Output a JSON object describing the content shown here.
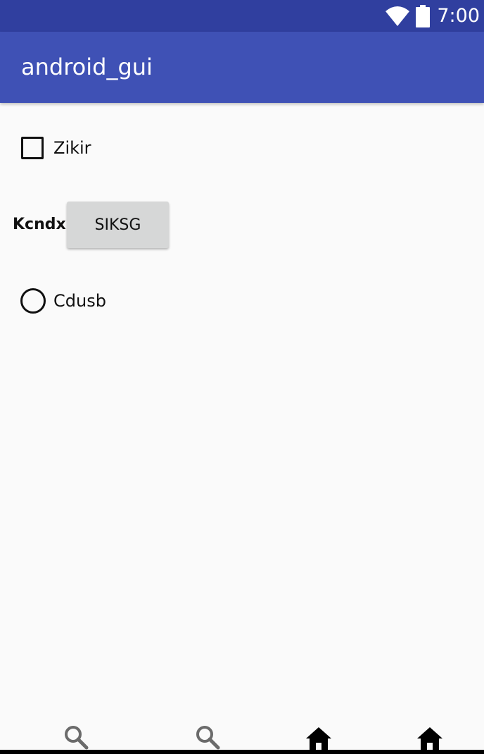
{
  "status_bar": {
    "time": "7:00",
    "icons": [
      "wifi-icon",
      "battery-icon"
    ],
    "color": "#303f9f"
  },
  "app_bar": {
    "title": "android_gui",
    "color": "#3f51b5"
  },
  "content": {
    "checkbox": {
      "label": "Zikir",
      "checked": false
    },
    "text_label": "Kcndx",
    "button": {
      "label": "SIKSG"
    },
    "radio": {
      "label": "Cdusb",
      "selected": false
    }
  },
  "bottom_nav": {
    "items": [
      {
        "icon": "search-icon"
      },
      {
        "icon": "search-icon"
      },
      {
        "icon": "home-icon"
      },
      {
        "icon": "home-icon"
      }
    ]
  }
}
